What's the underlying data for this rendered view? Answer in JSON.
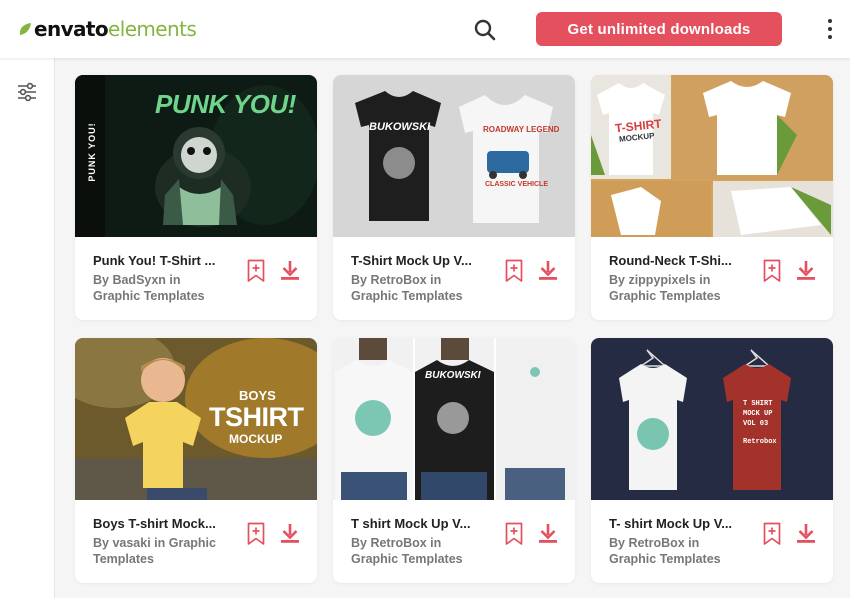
{
  "header": {
    "logo_part1": "envato",
    "logo_part2": "elements",
    "cta_label": "Get unlimited downloads"
  },
  "colors": {
    "accent": "#e5505e",
    "brand_green": "#82b541"
  },
  "icons": {
    "search": "search-icon",
    "menu": "kebab-menu-icon",
    "filter": "filter-sliders-icon",
    "bookmark": "bookmark-add-icon",
    "download": "download-icon"
  },
  "cards": [
    {
      "title": "Punk You! T-Shirt ...",
      "by_line": "By BadSyxn in",
      "category": "Graphic Templates",
      "thumb_text": {
        "headline": "PUNK YOU!",
        "side": "PUNK YOU!"
      }
    },
    {
      "title": "T-Shirt Mock Up V...",
      "by_line": "By RetroBox in",
      "category": "Graphic Templates",
      "thumb_text": {
        "shirt1": "BUKOWSKI",
        "shirt2_a": "ROADWAY LEGEND",
        "shirt2_b": "CLASSIC VEHICLE"
      }
    },
    {
      "title": "Round-Neck T-Shi...",
      "by_line": "By zippypixels in",
      "category": "Graphic Templates",
      "thumb_text": {
        "a": "T-SHIRT",
        "b": "MOCKUP"
      }
    },
    {
      "title": "Boys T-shirt Mock...",
      "by_line": "By vasaki in Graphic",
      "category": "Templates",
      "thumb_text": {
        "a": "BOYS",
        "b": "TSHIRT",
        "c": "MOCKUP"
      }
    },
    {
      "title": "T shirt Mock Up V...",
      "by_line": "By RetroBox in",
      "category": "Graphic Templates",
      "thumb_text": {
        "shirt": "BUKOWSKI"
      }
    },
    {
      "title": "T- shirt Mock Up V...",
      "by_line": "By RetroBox in",
      "category": "Graphic Templates",
      "thumb_text": {
        "a": "T SHIRT",
        "b": "MOCK UP",
        "c": "VOL 03",
        "d": "Retrobox"
      }
    }
  ]
}
